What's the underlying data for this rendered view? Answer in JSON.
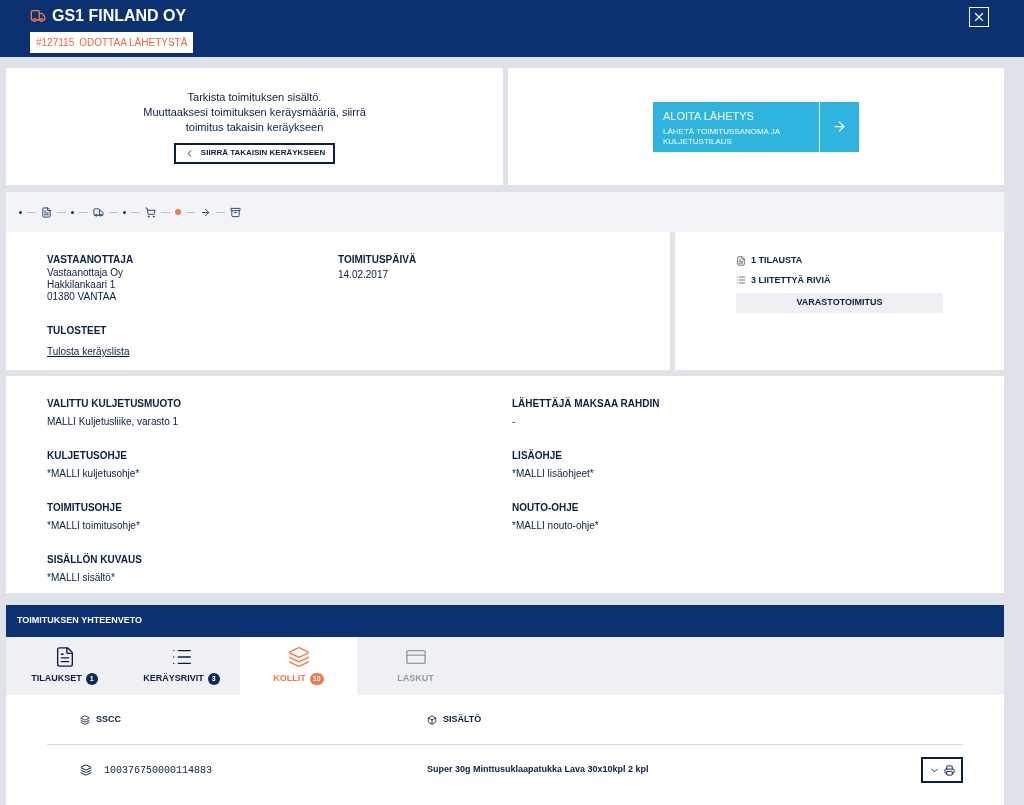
{
  "header": {
    "title": "GS1 FINLAND OY",
    "order_number": "#127115",
    "status": "ODOTTAA LÄHETYSTÄ"
  },
  "review": {
    "text": "Tarkista toimituksen sisältö.\nMuuttaaksesi toimituksen keräysmääriä, siirrä\ntoimitus takaisin keräykseen",
    "button": "SIIRRÄ TAKAISIN KERÄYKSEEN"
  },
  "start": {
    "title": "ALOITA LÄHETYS",
    "subtitle": "LÄHETÄ TOIMITUSSANOMA JA KULJETUSTILAUS"
  },
  "steps": [
    {
      "kind": "dot",
      "current": false
    },
    {
      "kind": "document",
      "current": false
    },
    {
      "kind": "dot",
      "current": false
    },
    {
      "kind": "truck",
      "current": false
    },
    {
      "kind": "dot",
      "current": false
    },
    {
      "kind": "cart",
      "current": false
    },
    {
      "kind": "dot",
      "current": true
    },
    {
      "kind": "arrow",
      "current": false
    },
    {
      "kind": "archive",
      "current": false
    }
  ],
  "recipient": {
    "label": "VASTAANOTTAJA",
    "lines": [
      "Vastaanottaja Oy",
      "Hakkilankaari 1",
      "01380 VANTAA"
    ]
  },
  "delivery_date": {
    "label": "TOIMITUSPÄIVÄ",
    "value": "14.02.2017"
  },
  "prints": {
    "label": "TULOSTEET",
    "link": "Tulosta keräyslista"
  },
  "counts": [
    {
      "kind": "document",
      "text": "1 TILAUSTA"
    },
    {
      "kind": "list",
      "text": "3 LIITETTYÄ RIVIÄ"
    }
  ],
  "delivery_type": "VARASTOTOIMITUS",
  "details": [
    {
      "label": "VALITTU KULJETUSMUOTO",
      "value": "MALLI Kuljetusliike, varasto 1"
    },
    {
      "label": "LÄHETTÄJÄ MAKSAA RAHDIN",
      "value": "-"
    },
    {
      "label": "KULJETUSOHJE",
      "value": "*MALLI kuljetusohje*"
    },
    {
      "label": "LISÄOHJE",
      "value": "*MALLI lisäohjeet*"
    },
    {
      "label": "TOIMITUSOHJE",
      "value": "*MALLI toimitusohje*"
    },
    {
      "label": "NOUTO-OHJE",
      "value": "*MALLI nouto-ohje*"
    },
    {
      "label": "SISÄLLÖN KUVAUS",
      "value": "*MALLI sisältö*"
    }
  ],
  "summary": {
    "title": "TOIMITUKSEN YHTEENVETO",
    "tabs": [
      {
        "kind": "orders",
        "label": "TILAUKSET",
        "count": "1",
        "selected": false,
        "disabled": false
      },
      {
        "kind": "rows",
        "label": "KERÄYSRIVIT",
        "count": "3",
        "selected": false,
        "disabled": false
      },
      {
        "kind": "parcels",
        "label": "KOLLIT",
        "count": "10",
        "selected": true,
        "disabled": false
      },
      {
        "kind": "invoices",
        "label": "LASKUT",
        "selected": false,
        "disabled": true
      }
    ],
    "columns": [
      "SSCC",
      "SISÄLTÖ"
    ],
    "rows": [
      {
        "sscc": "100376750000114883",
        "content": "Super 30g Minttusuklaapatukka Lava 30x10kpl 2 kpl"
      }
    ]
  }
}
